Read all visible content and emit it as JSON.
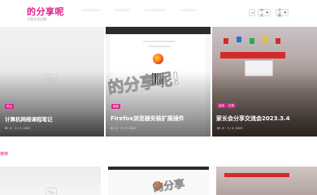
{
  "header": {
    "logo": "的分享呢",
    "tagline": "分享生活点滴",
    "lang_select": "中文",
    "theme_select": "主题"
  },
  "cards": [
    {
      "title": "计算机网络课程笔记",
      "badge": "笔记",
      "author": "BY 小",
      "date": "5 / 3, 2022"
    },
    {
      "title": "Firefox浏览器安装扩展插件",
      "badge": "教程",
      "author": "BY 小",
      "date": "5 / 3, 2022"
    },
    {
      "title": "家长会分享交流会2023.3.4",
      "badges": [
        "活动",
        "记录"
      ],
      "author": "BY 小",
      "date": "3 / 4, 2023"
    }
  ],
  "section2": {
    "label": "推荐"
  },
  "watermarks": [
    "的分享呢!",
    "的分享"
  ],
  "colors": {
    "accent": "#e0208a",
    "page_bg": "#ffffff"
  },
  "icons": {
    "placeholder": "image-placeholder-icon",
    "browser": "firefox-logo-icon"
  }
}
